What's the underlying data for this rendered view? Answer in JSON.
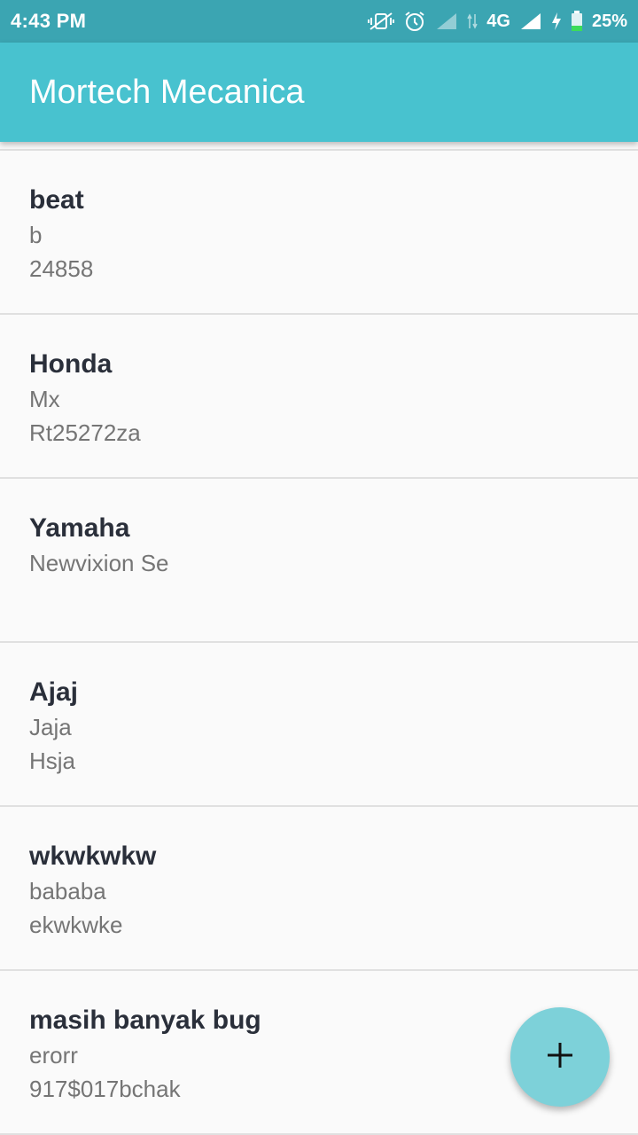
{
  "status_bar": {
    "time": "4:43 PM",
    "network": "4G",
    "battery": "25%",
    "icons": [
      "vibrate-off-icon",
      "alarm-icon",
      "signal-icon",
      "data-arrows-icon",
      "signal-icon",
      "charging-icon",
      "battery-icon"
    ]
  },
  "app_bar": {
    "title": "Mortech Mecanica",
    "color": "#48c2cf"
  },
  "list": {
    "items": [
      {
        "title": "beat",
        "line1": "b",
        "line2": "24858"
      },
      {
        "title": "Honda",
        "line1": "Mx",
        "line2": "Rt25272za"
      },
      {
        "title": "Yamaha",
        "line1": "Newvixion Se",
        "line2": ""
      },
      {
        "title": "Ajaj",
        "line1": "Jaja",
        "line2": "Hsja"
      },
      {
        "title": "wkwkwkw",
        "line1": "bababa",
        "line2": "ekwkwke"
      },
      {
        "title": "masih banyak bug",
        "line1": "erorr",
        "line2": "917$017bchak"
      }
    ]
  },
  "fab": {
    "icon": "plus-icon",
    "color": "#7dd1d9"
  }
}
